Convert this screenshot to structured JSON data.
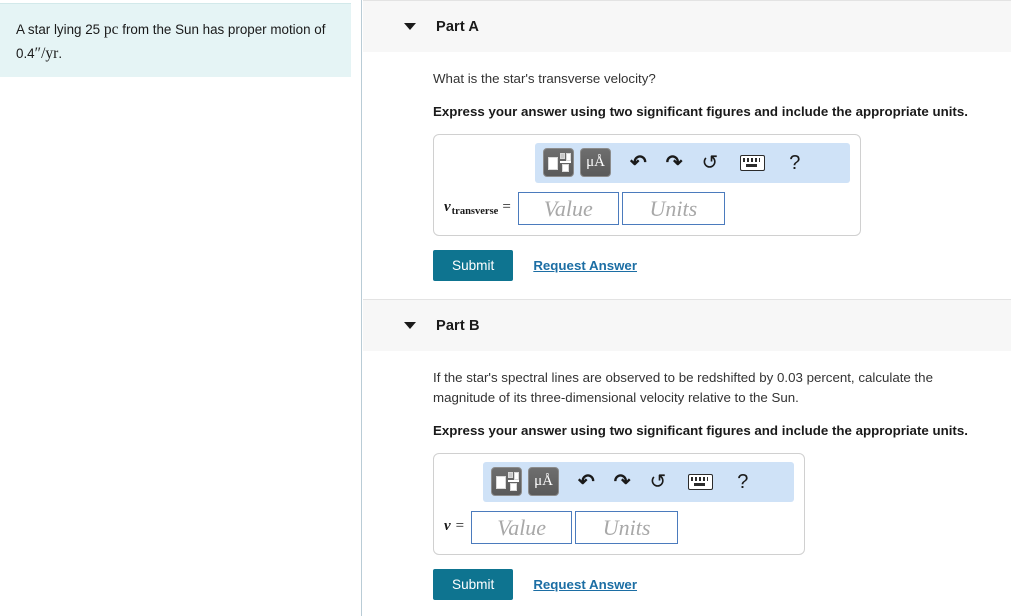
{
  "problem": {
    "text_before": "A star lying 25",
    "unit_pc": "pc",
    "text_middle": "from the Sun has proper motion of 0.4",
    "unit_arcsec": "″",
    "unit_slash": "/",
    "unit_yr": "yr",
    "text_end": "."
  },
  "toolbar": {
    "template_icon": "template-icon",
    "units_label": "μÅ",
    "undo_icon": "↶",
    "redo_icon": "↷",
    "reset_icon": "↺",
    "keyboard_icon": "keyboard-icon",
    "help_label": "?"
  },
  "fields": {
    "value_placeholder": "Value",
    "units_placeholder": "Units"
  },
  "actions": {
    "submit_label": "Submit",
    "request_answer_label": "Request Answer"
  },
  "colors": {
    "accent_teal": "#0e7490",
    "link_blue": "#1c6ea4",
    "mathbar_blue": "#cfe2f7",
    "problem_panel": "#e5f4f5",
    "header_gray": "#f7f7f7",
    "field_border": "#4b7bbd"
  },
  "parts": [
    {
      "id": "A",
      "title": "Part A",
      "question": "What is the star's transverse velocity?",
      "instruction": "Express your answer using two significant figures and include the appropriate units.",
      "variable": "v",
      "subscript": "transverse",
      "equals": "="
    },
    {
      "id": "B",
      "title": "Part B",
      "question": "If the star's spectral lines are observed to be redshifted by 0.03 percent, calculate the magnitude of its three-dimensional velocity relative to the Sun.",
      "instruction": "Express your answer using two significant figures and include the appropriate units.",
      "variable": "v",
      "subscript": "",
      "equals": "="
    }
  ]
}
